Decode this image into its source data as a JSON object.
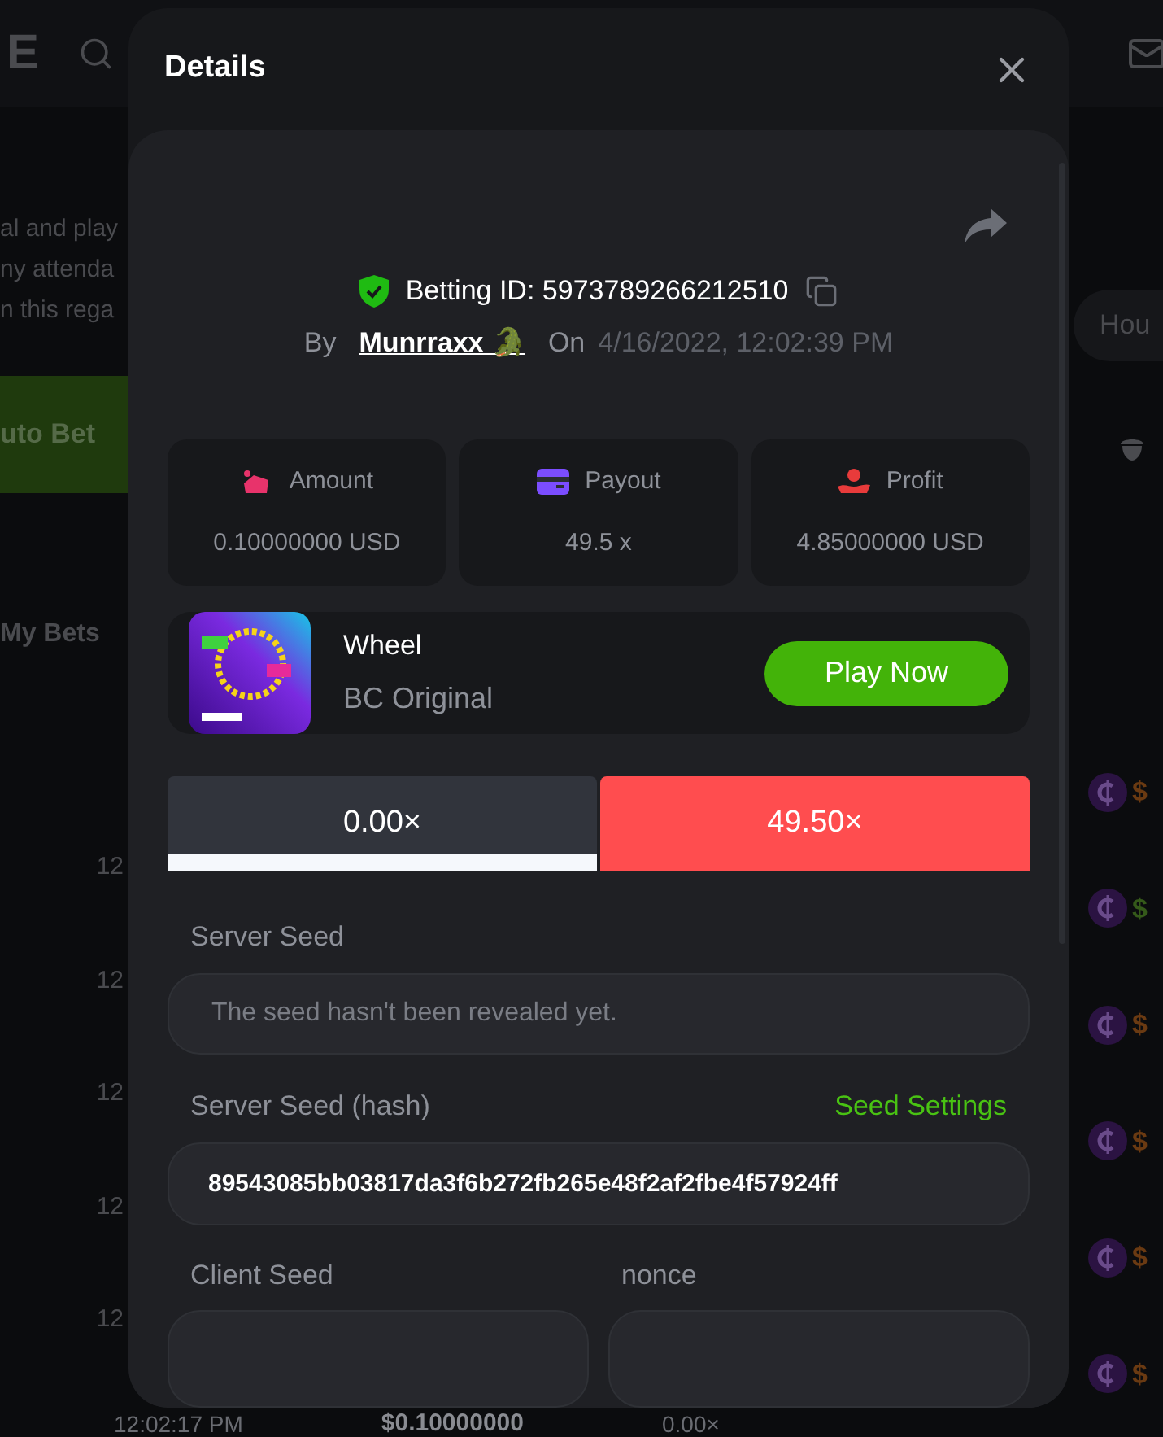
{
  "background": {
    "logo": "E",
    "left_text": [
      "al and play",
      "ny attenda",
      "n this rega"
    ],
    "auto_bet": "uto Bet",
    "my_bets": "My Bets",
    "times": [
      "12",
      "12",
      "12",
      "12",
      "12"
    ],
    "last_row": {
      "time": "12:02:17 PM",
      "amount": "$0.10000000",
      "payout": "0.00×"
    },
    "search_hint": "Hou",
    "amounts": [
      "$",
      "$",
      "$",
      "$",
      "$",
      "$"
    ]
  },
  "modal": {
    "title": "Details",
    "betting_id": "Betting ID: 5973789266212510",
    "by_label": "By",
    "user": "Munrraxx 🐊",
    "on_label": "On",
    "date": "4/16/2022, 12:02:39 PM",
    "stats": [
      {
        "kind": "amount",
        "label": "Amount",
        "value": "0.10000000 USD"
      },
      {
        "kind": "payout",
        "label": "Payout",
        "value": "49.5 x"
      },
      {
        "kind": "profit",
        "label": "Profit",
        "value": "4.85000000 USD"
      }
    ],
    "game": {
      "name": "Wheel",
      "provider": "BC Original",
      "button": "Play Now"
    },
    "results": [
      {
        "label": "0.00×",
        "selected": true,
        "color": "#31343c"
      },
      {
        "label": "49.50×",
        "selected": false,
        "color": "#ff4d4f"
      }
    ],
    "server_seed": {
      "label": "Server Seed",
      "placeholder": "The seed hasn't been revealed yet."
    },
    "hash": {
      "label": "Server Seed (hash)",
      "link": "Seed Settings",
      "value": "89543085bb03817da3f6b272fb265e48f2af2fbe4f57924ff"
    },
    "client_seed": {
      "label": "Client Seed"
    },
    "nonce": {
      "label": "nonce"
    }
  }
}
